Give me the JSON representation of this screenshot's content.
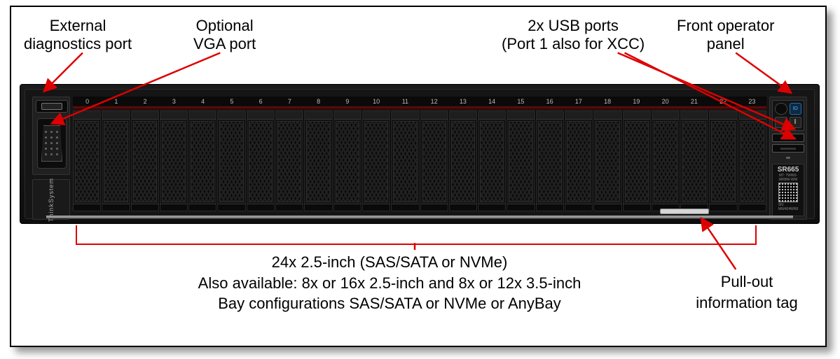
{
  "labels": {
    "diag": {
      "line1": "External",
      "line2": "diagnostics port"
    },
    "vga": {
      "line1": "Optional",
      "line2": "VGA port"
    },
    "usb": {
      "line1": "2x USB ports",
      "line2": "(Port 1 also for XCC)"
    },
    "op": {
      "line1": "Front operator",
      "line2": "panel"
    },
    "pullout": {
      "line1": "Pull-out",
      "line2": "information tag"
    }
  },
  "caption": {
    "line1": "24x 2.5-inch (SAS/SATA or NVMe)",
    "line2": "Also available: 8x or 16x 2.5-inch and 8x or 12x 3.5-inch",
    "line3": "Bay configurations SAS/SATA or NVMe or AnyBay"
  },
  "chassis": {
    "brand": "ThinkSystem",
    "model": "SR665",
    "mt_line1": "MT: 7WW0-",
    "mt_line2": "WR8W-WW",
    "sn_label": "SN:",
    "sn_value": "MW404WR8",
    "id_label": "ID",
    "bays": [
      "0",
      "1",
      "2",
      "3",
      "4",
      "5",
      "6",
      "7",
      "8",
      "9",
      "10",
      "11",
      "12",
      "13",
      "14",
      "15",
      "16",
      "17",
      "18",
      "19",
      "20",
      "21",
      "22",
      "23"
    ]
  }
}
